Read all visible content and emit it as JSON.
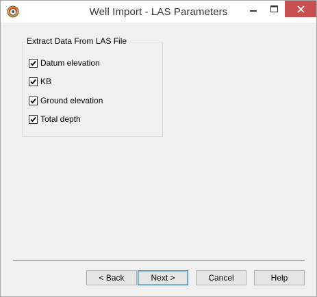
{
  "window": {
    "title": "Well Import - LAS Parameters",
    "app_icon": "petrel-swirl-icon",
    "controls": {
      "minimize_icon": "minimize-icon",
      "maximize_icon": "maximize-icon",
      "close_icon": "close-icon",
      "close_color": "#c75050"
    }
  },
  "group": {
    "label": "Extract Data From LAS File",
    "options": [
      {
        "label": "Datum elevation",
        "checked": true
      },
      {
        "label": "KB",
        "checked": true
      },
      {
        "label": "Ground elevation",
        "checked": true
      },
      {
        "label": "Total depth",
        "checked": true
      }
    ]
  },
  "buttons": {
    "back": "< Back",
    "next": "Next >",
    "cancel": "Cancel",
    "help": "Help"
  },
  "colors": {
    "default_button_border": "#3c7fb1",
    "dialog_background": "#f0f0f0"
  }
}
